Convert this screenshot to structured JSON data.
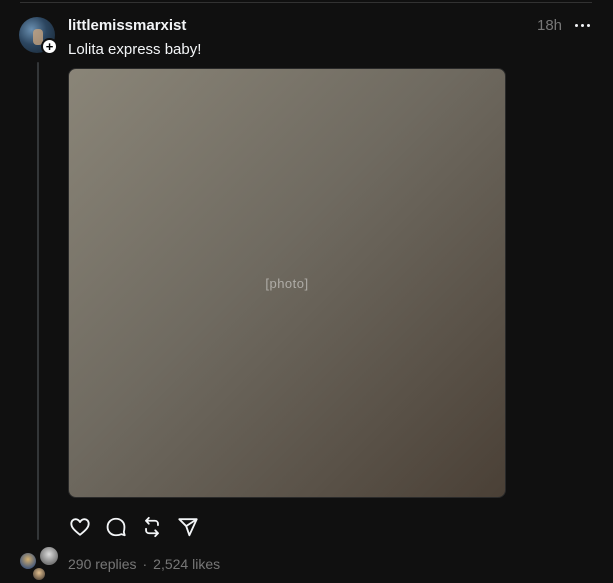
{
  "post": {
    "username": "littlemissmarxist",
    "timestamp": "18h",
    "caption": "Lolita express baby!",
    "follow_badge": "+",
    "more_icon": "ellipsis-icon"
  },
  "actions": {
    "like_icon": "heart-icon",
    "reply_icon": "comment-icon",
    "repost_icon": "repost-icon",
    "share_icon": "send-icon"
  },
  "stats": {
    "replies": "290 replies",
    "separator": "·",
    "likes": "2,524 likes"
  },
  "colors": {
    "background": "#101010",
    "text_primary": "#f3f5f7",
    "text_secondary": "#777777",
    "thread_line": "#333638"
  }
}
